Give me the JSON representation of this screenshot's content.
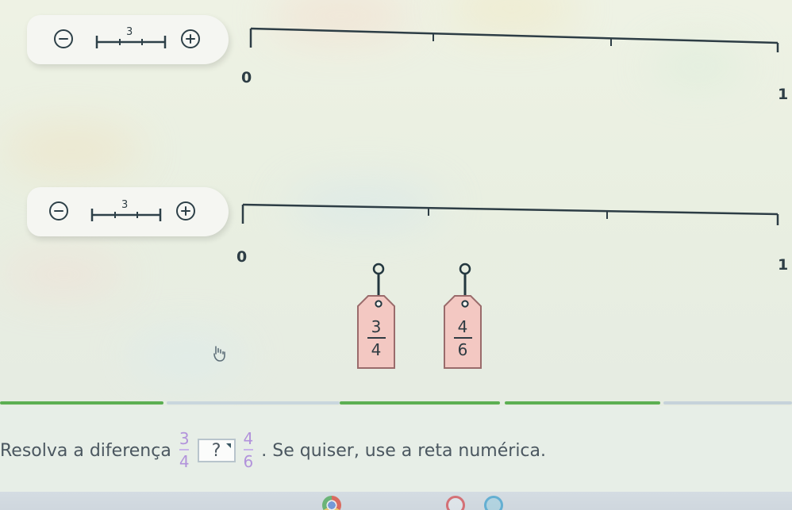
{
  "number_lines": [
    {
      "minus_label": "−",
      "plus_label": "+",
      "partition_count": "3",
      "start_label": "0",
      "end_label": "1"
    },
    {
      "minus_label": "−",
      "plus_label": "+",
      "partition_count": "3",
      "start_label": "0",
      "end_label": "1"
    }
  ],
  "tags": [
    {
      "numerator": "3",
      "denominator": "4"
    },
    {
      "numerator": "4",
      "denominator": "6"
    }
  ],
  "question": {
    "prefix": "Resolva a diferença",
    "left_numerator": "3",
    "left_denominator": "4",
    "answer_value": "?",
    "right_numerator": "4",
    "right_denominator": "6",
    "suffix": ". Se quiser, use a reta numérica."
  },
  "colors": {
    "accent_purple": "#b293db",
    "progress_green": "#5caf52",
    "tag_fill": "#f3c8c2"
  },
  "icons": [
    "minus-icon",
    "plus-icon",
    "segment-icon",
    "hand-cursor-icon",
    "chrome-icon",
    "red-circle-icon",
    "blue-circle-icon"
  ]
}
